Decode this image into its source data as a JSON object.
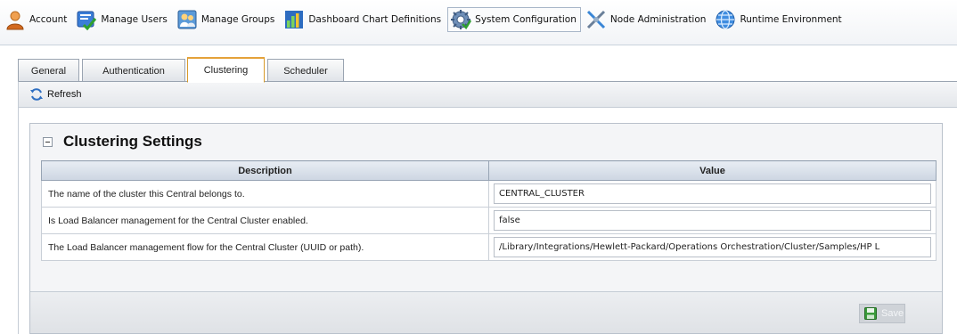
{
  "nav": {
    "items": [
      {
        "label": "Account",
        "icon": "account-icon"
      },
      {
        "label": "Manage Users",
        "icon": "manage-users-icon"
      },
      {
        "label": "Manage Groups",
        "icon": "manage-groups-icon"
      },
      {
        "label": "Dashboard Chart Definitions",
        "icon": "bar-chart-icon"
      },
      {
        "label": "System Configuration",
        "icon": "system-configuration-icon"
      },
      {
        "label": "Node Administration",
        "icon": "node-administration-icon"
      },
      {
        "label": "Runtime Environment",
        "icon": "globe-icon"
      }
    ],
    "active": "System Configuration"
  },
  "tabs": {
    "items": [
      "General",
      "Authentication",
      "Clustering",
      "Scheduler"
    ],
    "active": "Clustering"
  },
  "toolbar": {
    "refresh_label": "Refresh"
  },
  "settings": {
    "title": "Clustering Settings",
    "columns": {
      "description": "Description",
      "value": "Value"
    },
    "rows": [
      {
        "description": "The name of the cluster this Central belongs to.",
        "value": "CENTRAL_CLUSTER"
      },
      {
        "description": "Is Load Balancer management for the Central Cluster enabled.",
        "value": "false"
      },
      {
        "description": "The Load Balancer management flow for the Central Cluster (UUID or path).",
        "value": "/Library/Integrations/Hewlett-Packard/Operations Orchestration/Cluster/Samples/HP L"
      }
    ],
    "save_label": "Save",
    "save_enabled": false
  },
  "colors": {
    "active_tab_accent": "#e5a23a",
    "header_fill": "#cdd6e2"
  }
}
